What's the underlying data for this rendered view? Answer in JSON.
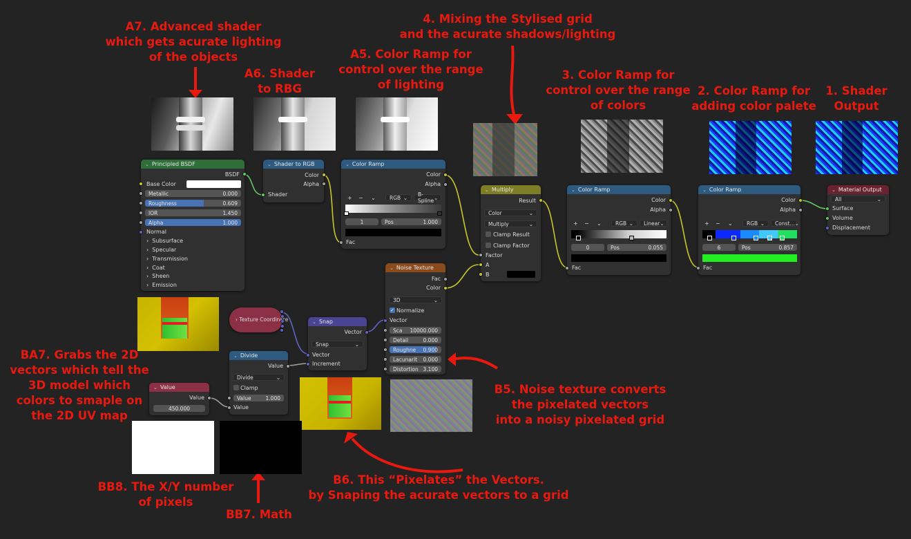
{
  "annotations": {
    "a7": "A7. Advanced shader\nwhich gets acurate lighting\nof the objects",
    "a6": "A6. Shader\nto RBG",
    "a5": "A5. Color Ramp for\ncontrol over the range\nof lighting",
    "s4": "4. Mixing the Stylised grid\nand the acurate shadows/lighting",
    "s3": "3. Color Ramp for\ncontrol over the range\nof colors",
    "s2": "2. Color Ramp for\nadding color palete",
    "s1": "1. Shader\nOutput",
    "ba7": "BA7. Grabs the 2D\nvectors which tell the\n3D model which\ncolors to smaple on\nthe 2D UV map",
    "b5": "B5. Noise texture converts\nthe pixelated vectors\ninto a noisy pixelated grid",
    "b6": "B6. This “Pixelates” the Vectors.\nby Snaping the acurate vectors to a grid",
    "bb8": "BB8. The X/Y number\nof pixels",
    "bb7": "BB7. Math"
  },
  "principled": {
    "title": "Principled BSDF",
    "out": "BSDF",
    "base_color": "Base Color",
    "metallic": "Metallic",
    "metallic_val": "0.000",
    "roughness": "Roughness",
    "roughness_val": "0.609",
    "ior": "IOR",
    "ior_val": "1.450",
    "alpha": "Alpha",
    "alpha_val": "1.000",
    "normal": "Normal",
    "panels": [
      "Subsurface",
      "Specular",
      "Transmission",
      "Coat",
      "Sheen",
      "Emission"
    ]
  },
  "shader_rgb": {
    "title": "Shader to RGB",
    "color": "Color",
    "alpha": "Alpha",
    "shader": "Shader"
  },
  "ramp_a": {
    "title": "Color Ramp",
    "color": "Color",
    "alpha": "Alpha",
    "mode": "RGB",
    "interp": "B-Spline",
    "index": "1",
    "pos": "Pos",
    "pos_val": "1.000",
    "fac": "Fac"
  },
  "multiply": {
    "title": "Multiply",
    "result": "Result",
    "dd1": "Color",
    "dd2": "Multiply",
    "clamp_result": "Clamp Result",
    "clamp_factor": "Clamp Factor",
    "factor": "Factor",
    "a": "A",
    "b": "B"
  },
  "ramp_3": {
    "title": "Color Ramp",
    "color": "Color",
    "alpha": "Alpha",
    "mode": "RGB",
    "interp": "Linear",
    "index": "0",
    "pos": "Pos",
    "pos_val": "0.055",
    "fac": "Fac"
  },
  "ramp_2": {
    "title": "Color Ramp",
    "color": "Color",
    "alpha": "Alpha",
    "mode": "RGB",
    "interp": "Const...",
    "index": "6",
    "pos": "Pos",
    "pos_val": "0.857",
    "fac": "Fac"
  },
  "output": {
    "title": "Material Output",
    "target": "All",
    "surface": "Surface",
    "volume": "Volume",
    "displacement": "Displacement"
  },
  "noise": {
    "title": "Noise Texture",
    "fac": "Fac",
    "color": "Color",
    "dim": "3D",
    "normalize": "Normalize",
    "vector": "Vector",
    "scale": "Sca",
    "scale_val": "10000.000",
    "detail": "Detail",
    "detail_val": "0.000",
    "rough": "Roughne",
    "rough_val": "0.900",
    "lac": "Lacunarit",
    "lac_val": "0.000",
    "dist": "Distortion",
    "dist_val": "3.100"
  },
  "texcoord": {
    "title": "Texture Coordinate"
  },
  "snap": {
    "title": "Snap",
    "vector_out": "Vector",
    "op": "Snap",
    "vector": "Vector",
    "increment": "Increment"
  },
  "divide": {
    "title": "Divide",
    "value_out": "Value",
    "op": "Divide",
    "clamp": "Clamp",
    "val_label": "Value",
    "val": "1.000",
    "value": "Value"
  },
  "value_node": {
    "title": "Value",
    "out": "Value",
    "val": "450.000"
  },
  "colors": {
    "accent_red": "#e8190f",
    "shader_header": "#2f6e3b",
    "converter_header": "#2d5a7e",
    "color_header": "#7e7e26",
    "texture_header": "#8a4b1c",
    "input_header": "#8b3045",
    "vector_header": "#4a4593",
    "output_header": "#6b2230"
  }
}
